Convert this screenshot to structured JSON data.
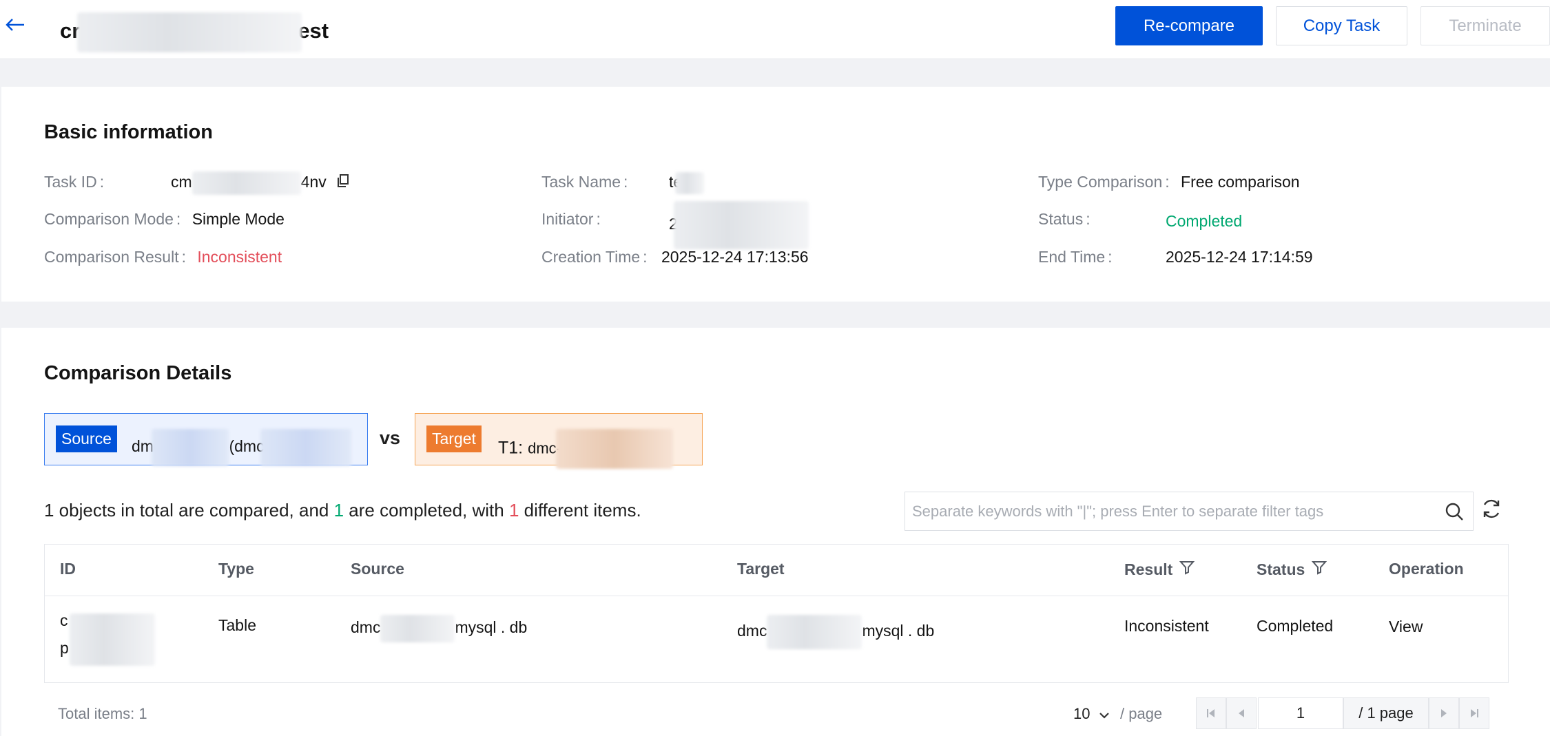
{
  "header": {
    "title_prefix": "cr",
    "title_suffix": "est",
    "recompare_label": "Re-compare",
    "copy_task_label": "Copy Task",
    "terminate_label": "Terminate"
  },
  "basic": {
    "title": "Basic information",
    "task_id_label": "Task ID",
    "task_id_prefix": "cm",
    "task_id_suffix": "4nv",
    "task_name_label": "Task Name",
    "task_name_prefix": "te",
    "type_comparison_label": "Type Comparison",
    "type_comparison_value": "Free comparison",
    "comparison_mode_label": "Comparison Mode",
    "comparison_mode_value": "Simple Mode",
    "initiator_label": "Initiator",
    "initiator_prefix": "2",
    "status_label": "Status",
    "status_value": "Completed",
    "comparison_result_label": "Comparison Result",
    "comparison_result_value": "Inconsistent",
    "creation_time_label": "Creation Time",
    "creation_time_value": "2025-12-24 17:13:56",
    "end_time_label": "End Time",
    "end_time_value": "2025-12-24 17:14:59",
    "colon": ":"
  },
  "details": {
    "title": "Comparison Details",
    "source_tag": "Source",
    "source_prefix": "dmc",
    "source_mid": "(dmc",
    "vs_label": "vs",
    "target_tag": "Target",
    "target_t1": "T1:",
    "target_prefix": "dmc-",
    "summary_a": "1 objects in total are compared, and ",
    "summary_completed": "1",
    "summary_b": " are completed, with ",
    "summary_diff": "1",
    "summary_c": " different items.",
    "search_placeholder": "Separate keywords with \"|\"; press Enter to separate filter tags"
  },
  "table": {
    "columns": [
      "ID",
      "Type",
      "Source",
      "Target",
      "Result",
      "Status",
      "Operation"
    ],
    "rows": [
      {
        "id_line1": "c",
        "id_line2": "p",
        "type": "Table",
        "source_prefix": "dmc",
        "source_suffix": "mysql . db",
        "target_prefix": "dmc",
        "target_suffix": "mysql . db",
        "result": "Inconsistent",
        "status": "Completed",
        "operation": "View"
      }
    ]
  },
  "pagination": {
    "total_label": "Total items: 1",
    "page_size": "10",
    "per_page_label": "/ page",
    "current_page": "1",
    "total_pages_label": "/ 1 page"
  },
  "colors": {
    "primary": "#0052d9",
    "success": "#00a870",
    "danger": "#e34d59",
    "target_accent": "#ed7b2f"
  }
}
